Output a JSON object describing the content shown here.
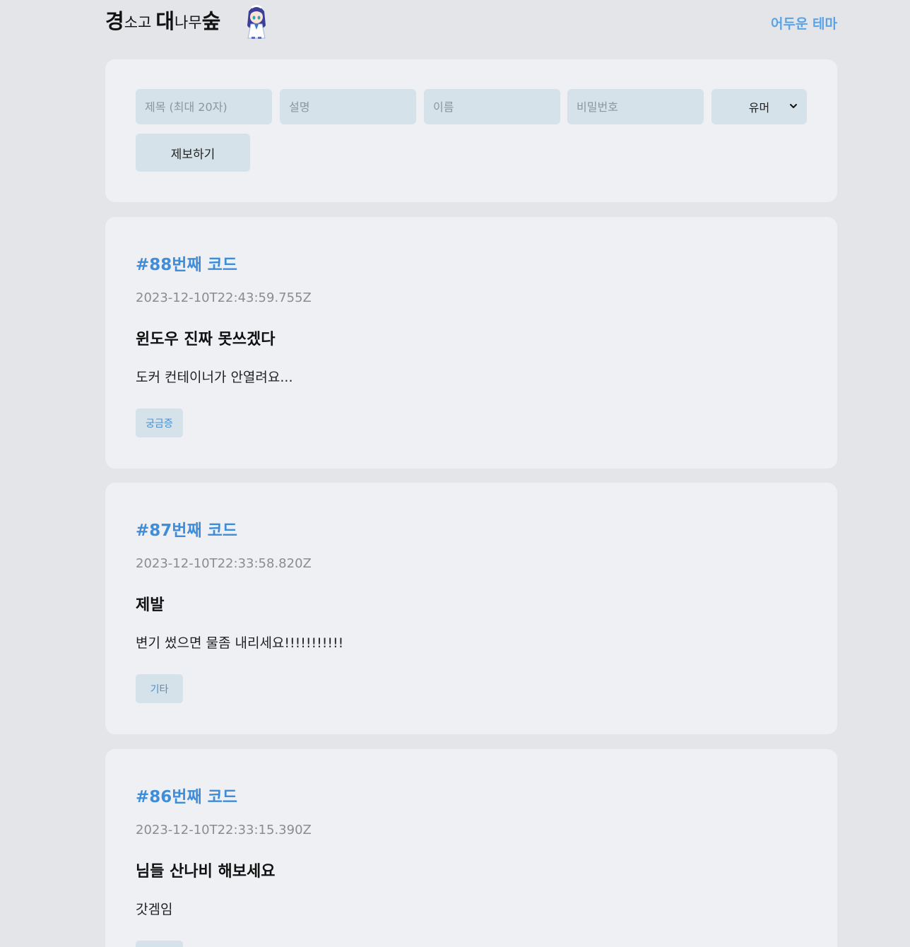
{
  "header": {
    "logo": {
      "part1_big": "경",
      "part1_small": "소고",
      "part2_big": "대",
      "part2_small": "나무",
      "part3_big": "숲"
    },
    "mascot_icon": "anime-mascot-icon",
    "theme_toggle_label": "어두운 테마"
  },
  "form": {
    "title_placeholder": "제목 (최대 20자)",
    "desc_placeholder": "설명",
    "name_placeholder": "이름",
    "password_placeholder": "비밀번호",
    "category_selected": "유머",
    "submit_label": "제보하기"
  },
  "posts": [
    {
      "code": "#88번째 코드",
      "timestamp": "2023-12-10T22:43:59.755Z",
      "title": "윈도우 진짜 못쓰겠다",
      "description": "도커 컨테이너가 안열려요...",
      "tag": "궁금증"
    },
    {
      "code": "#87번째 코드",
      "timestamp": "2023-12-10T22:33:58.820Z",
      "title": "제발",
      "description": "변기 썼으면 물좀 내리세요!!!!!!!!!!!",
      "tag": "기타"
    },
    {
      "code": "#86번째 코드",
      "timestamp": "2023-12-10T22:33:15.390Z",
      "title": "님들 산나비 해보세요",
      "description": "갓겜임",
      "tag": ""
    }
  ],
  "colors": {
    "background": "#e4e5e9",
    "card": "#eff0f3",
    "field": "#d5e2ea",
    "accent": "#3f8dd8",
    "theme_link": "#5aa3e6"
  }
}
